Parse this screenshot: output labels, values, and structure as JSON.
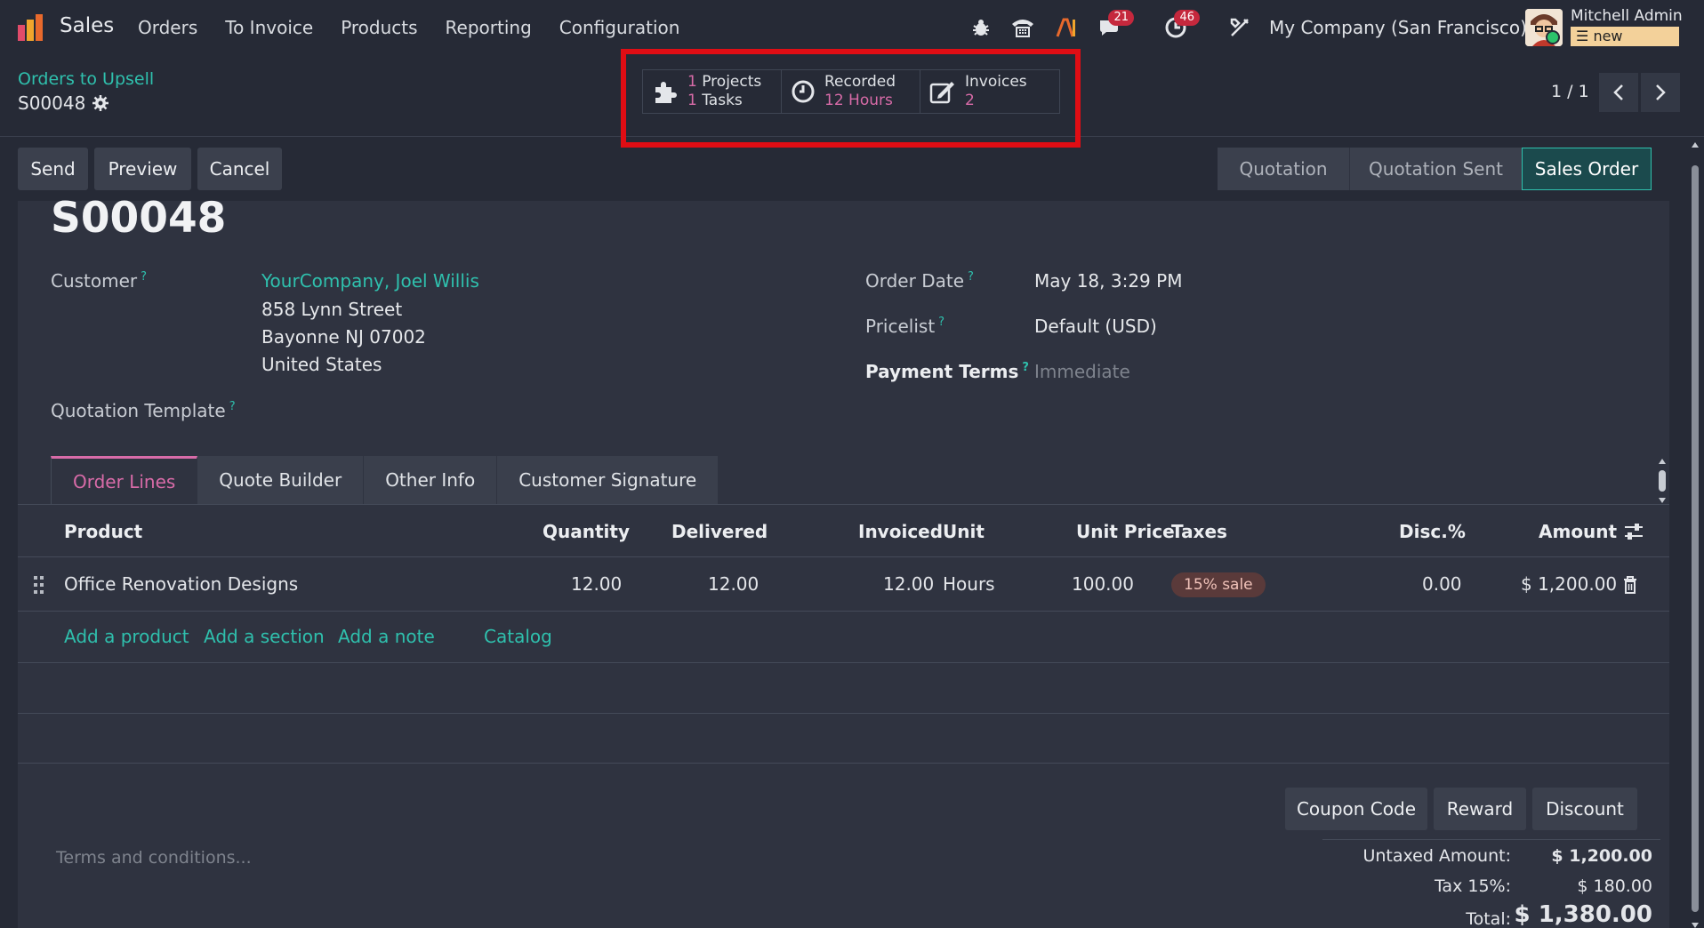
{
  "topbar": {
    "app_name": "Sales",
    "menu": [
      "Orders",
      "To Invoice",
      "Products",
      "Reporting",
      "Configuration"
    ],
    "messages_badge": "21",
    "activities_badge": "46",
    "company": "My Company (San Francisco)",
    "user_name": "Mitchell Admin",
    "db_name": "new"
  },
  "control": {
    "breadcrumb": "Orders to Upsell",
    "record": "S00048",
    "smart_buttons": {
      "projects_count": "1",
      "projects_label": "Projects",
      "tasks_count": "1",
      "tasks_label": "Tasks",
      "recorded_label": "Recorded",
      "recorded_value": "12 Hours",
      "invoices_label": "Invoices",
      "invoices_count": "2"
    },
    "pager": "1 / 1"
  },
  "actions": {
    "send": "Send",
    "preview": "Preview",
    "cancel": "Cancel",
    "stages": [
      "Quotation",
      "Quotation Sent",
      "Sales Order"
    ]
  },
  "form": {
    "title": "S00048",
    "customer_label": "Customer",
    "customer_name": "YourCompany, Joel Willis",
    "address_line1": "858 Lynn Street",
    "address_line2": "Bayonne NJ 07002",
    "address_line3": "United States",
    "template_label": "Quotation Template",
    "order_date_label": "Order Date",
    "order_date": "May 18, 3:29 PM",
    "pricelist_label": "Pricelist",
    "pricelist": "Default (USD)",
    "payment_terms_label": "Payment Terms",
    "payment_terms_placeholder": "Immediate"
  },
  "tabs": [
    "Order Lines",
    "Quote Builder",
    "Other Info",
    "Customer Signature"
  ],
  "table": {
    "headers": {
      "product": "Product",
      "quantity": "Quantity",
      "delivered": "Delivered",
      "invoiced": "Invoiced",
      "unit": "Unit",
      "unit_price": "Unit Price",
      "taxes": "Taxes",
      "disc": "Disc.%",
      "amount": "Amount"
    },
    "rows": [
      {
        "product": "Office Renovation Designs",
        "quantity": "12.00",
        "delivered": "12.00",
        "invoiced": "12.00",
        "unit": "Hours",
        "unit_price": "100.00",
        "tax": "15% sale",
        "disc": "0.00",
        "amount": "$ 1,200.00"
      }
    ],
    "add_links": [
      "Add a product",
      "Add a section",
      "Add a note",
      "Catalog"
    ]
  },
  "footer": {
    "coupon": "Coupon Code",
    "reward": "Reward",
    "discount": "Discount",
    "terms_placeholder": "Terms and conditions...",
    "untaxed_label": "Untaxed Amount:",
    "untaxed_value": "$ 1,200.00",
    "tax_label": "Tax 15%:",
    "tax_value": "$ 180.00",
    "total_label": "Total:",
    "total_value": "$ 1,380.00"
  },
  "colors": {
    "accent_teal": "#2fc0ad",
    "accent_pink": "#d86ba8",
    "highlight_red": "#e00d14",
    "background": "#262a36"
  }
}
